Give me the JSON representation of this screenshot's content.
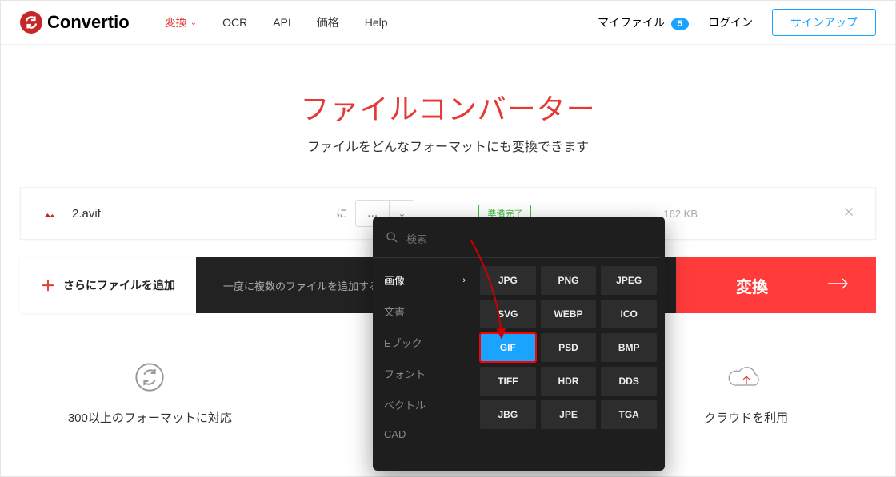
{
  "header": {
    "logo_text": "Convertio",
    "nav": {
      "convert": "変換",
      "ocr": "OCR",
      "api": "API",
      "pricing": "価格",
      "help": "Help"
    },
    "right": {
      "myfiles": "マイファイル",
      "badge": "5",
      "login": "ログイン",
      "signup": "サインアップ"
    }
  },
  "hero": {
    "title": "ファイルコンバーター",
    "subtitle": "ファイルをどんなフォーマットにも変換できます"
  },
  "file": {
    "name": "2.avif",
    "to_label": "に",
    "dots": "...",
    "status": "準備完了",
    "size": "162 KB"
  },
  "actions": {
    "add_more": "さらにファイルを追加",
    "hint": "一度に複数のファイルを追加するにはここにドロップしてください",
    "convert": "変換"
  },
  "dropdown": {
    "search_placeholder": "検索",
    "categories": [
      "画像",
      "文書",
      "Eブック",
      "フォント",
      "ベクトル",
      "CAD"
    ],
    "active_category_index": 0,
    "formats": [
      "JPG",
      "PNG",
      "JPEG",
      "SVG",
      "WEBP",
      "ICO",
      "GIF",
      "PSD",
      "BMP",
      "TIFF",
      "HDR",
      "DDS",
      "JBG",
      "JPE",
      "TGA"
    ],
    "selected_format_index": 6
  },
  "features": {
    "a": "300以上のフォーマットに対応",
    "c": "クラウドを利用"
  }
}
